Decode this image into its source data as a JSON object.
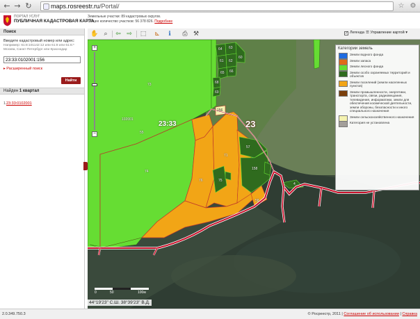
{
  "browser": {
    "url_host": "maps.rosreestr.ru",
    "url_path": "/Portal/",
    "back_icon": "back-arrow-icon",
    "forward_icon": "forward-arrow-icon"
  },
  "header": {
    "portal_small": "ПОРТАЛ УСЛУГ",
    "portal_title": "ПУБЛИЧНАЯ КАДАСТРОВАЯ КАРТА",
    "stats_line1": "Земельные участки: 89 кадастровых округов.",
    "stats_line2": "Общее количество участков: 56 378 826.",
    "stats_link": "Подробнее"
  },
  "sidebar": {
    "search_title": "Поиск",
    "search_hint": "Введите кадастровый номер или адрес:",
    "search_hint_sub": "Например: 61:8:101142:12 или 61:8 или 61:6:*",
    "search_hint_sub2": "Москва, Санкт-Петербург или Краснодар",
    "search_value": "23:33:0102001:156",
    "extended_search": "Расширенный поиск",
    "find_button": "Найти",
    "found_label": "Найден",
    "found_count": "1 квартал",
    "result_item": "23:33:0102001"
  },
  "toolbar": {
    "legend_label": "Легенда",
    "legend_checked": "✓",
    "map_control": "Управление картой"
  },
  "legend": {
    "title": "Категории земель",
    "items": [
      {
        "label": "Земли водного фонда",
        "color": "#1e6be0"
      },
      {
        "label": "Земли запаса",
        "color": "#e06a1a"
      },
      {
        "label": "Земли лесного фонда",
        "color": "#66dd33"
      },
      {
        "label": "Земли особо охраняемых территорий и объектов",
        "color": "#2f6b1e"
      },
      {
        "label": "Земли поселений (земли населенных пунктов)",
        "color": "#f2a516"
      },
      {
        "label": "Земли промышленности, энергетики, транспорта, связи, радиовещания, телевидения, информатики, земли для обеспечения космической деятельности, земли обороны, безопасности и иного специального назначения",
        "color": "#7a3f0c"
      },
      {
        "label": "Земли сельскохозяйственного назначения",
        "color": "#f4f2b0"
      },
      {
        "label": "Категория не установлена",
        "color": "#a39f9a"
      }
    ]
  },
  "map": {
    "district_number": "23",
    "quarter_number": "23:33",
    "plot_labels": [
      "102001",
      "73",
      "55",
      "74",
      "156",
      "71",
      "76",
      "75",
      "57",
      "158",
      "58",
      "64",
      "63",
      "60",
      "61",
      "62",
      "65",
      "66",
      "68",
      "69",
      "4"
    ],
    "scale_labels": [
      "0",
      "50",
      "100м"
    ],
    "coords": "44°19'23\" С.Ш.   38°39'23\" В.Д."
  },
  "status": {
    "left": "2.0.349.750.3",
    "copyright": "© Росреестр, 2011",
    "terms_link": "Соглашение об использовании",
    "help_link": "Справка"
  }
}
